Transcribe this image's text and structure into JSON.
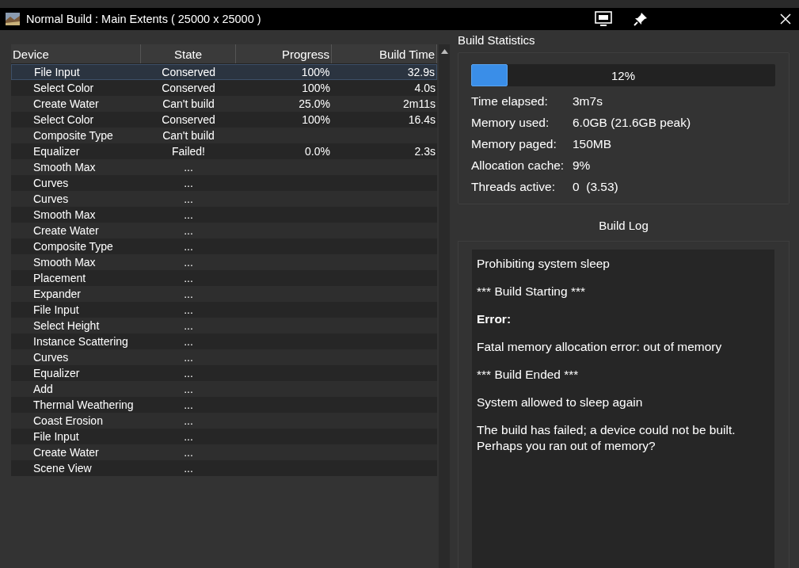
{
  "window": {
    "title": "Normal Build : Main Extents ( 25000 x 25000 )"
  },
  "table": {
    "columns": [
      "Device",
      "State",
      "Progress",
      "Build Time"
    ],
    "rows": [
      {
        "device": "File Input",
        "state": "Conserved",
        "progress": "100%",
        "build_time": "32.9s",
        "selected": true
      },
      {
        "device": "Select Color",
        "state": "Conserved",
        "progress": "100%",
        "build_time": "4.0s",
        "selected": false
      },
      {
        "device": "Create Water",
        "state": "Can't build",
        "progress": "25.0%",
        "build_time": "2m11s",
        "selected": false
      },
      {
        "device": "Select Color",
        "state": "Conserved",
        "progress": "100%",
        "build_time": "16.4s",
        "selected": false
      },
      {
        "device": "Composite Type",
        "state": "Can't build",
        "selected": false
      },
      {
        "device": "Equalizer",
        "state": "Failed!",
        "progress": "0.0%",
        "build_time": "2.3s",
        "selected": false
      },
      {
        "device": "Smooth Max",
        "state": "...",
        "selected": false
      },
      {
        "device": "Curves",
        "state": "...",
        "selected": false
      },
      {
        "device": "Curves",
        "state": "...",
        "selected": false
      },
      {
        "device": "Smooth Max",
        "state": "...",
        "selected": false
      },
      {
        "device": "Create Water",
        "state": "...",
        "selected": false
      },
      {
        "device": "Composite Type",
        "state": "...",
        "selected": false
      },
      {
        "device": "Smooth Max",
        "state": "...",
        "selected": false
      },
      {
        "device": "Placement",
        "state": "...",
        "selected": false
      },
      {
        "device": "Expander",
        "state": "...",
        "selected": false
      },
      {
        "device": "File Input",
        "state": "...",
        "selected": false
      },
      {
        "device": "Select Height",
        "state": "...",
        "selected": false
      },
      {
        "device": "Instance Scattering",
        "state": "...",
        "selected": false
      },
      {
        "device": "Curves",
        "state": "...",
        "selected": false
      },
      {
        "device": "Equalizer",
        "state": "...",
        "selected": false
      },
      {
        "device": "Add",
        "state": "...",
        "selected": false
      },
      {
        "device": "Thermal Weathering",
        "state": "...",
        "selected": false
      },
      {
        "device": "Coast Erosion",
        "state": "...",
        "selected": false
      },
      {
        "device": "File Input",
        "state": "...",
        "selected": false
      },
      {
        "device": "Create Water",
        "state": "...",
        "selected": false
      },
      {
        "device": "Scene View",
        "state": "...",
        "selected": false
      }
    ]
  },
  "build_statistics": {
    "title": "Build Statistics",
    "progress": {
      "level": 0.12,
      "label": "12%"
    },
    "stats": [
      {
        "label": "Time elapsed:",
        "value": "3m7s"
      },
      {
        "label": "Memory used:",
        "value": "6.0GB (21.6GB peak)"
      },
      {
        "label": "Memory paged:",
        "value": "150MB"
      },
      {
        "label": "Allocation cache:",
        "value": "9%"
      },
      {
        "label": "Threads active:",
        "value": "0  (3.53)"
      }
    ]
  },
  "build_log": {
    "title": "Build Log",
    "entries": [
      {
        "kind": "text",
        "text": "Prohibiting system sleep"
      },
      {
        "kind": "text",
        "text": "*** Build Starting ***"
      },
      {
        "kind": "heading",
        "text": "Error:"
      },
      {
        "kind": "text",
        "text": "Fatal memory allocation error: out of memory"
      },
      {
        "kind": "text",
        "text": "*** Build Ended ***"
      },
      {
        "kind": "text",
        "text": "System allowed to sleep again"
      },
      {
        "kind": "text",
        "text": "The build has failed; a device could not be built. Perhaps you ran out of memory?"
      }
    ]
  }
}
